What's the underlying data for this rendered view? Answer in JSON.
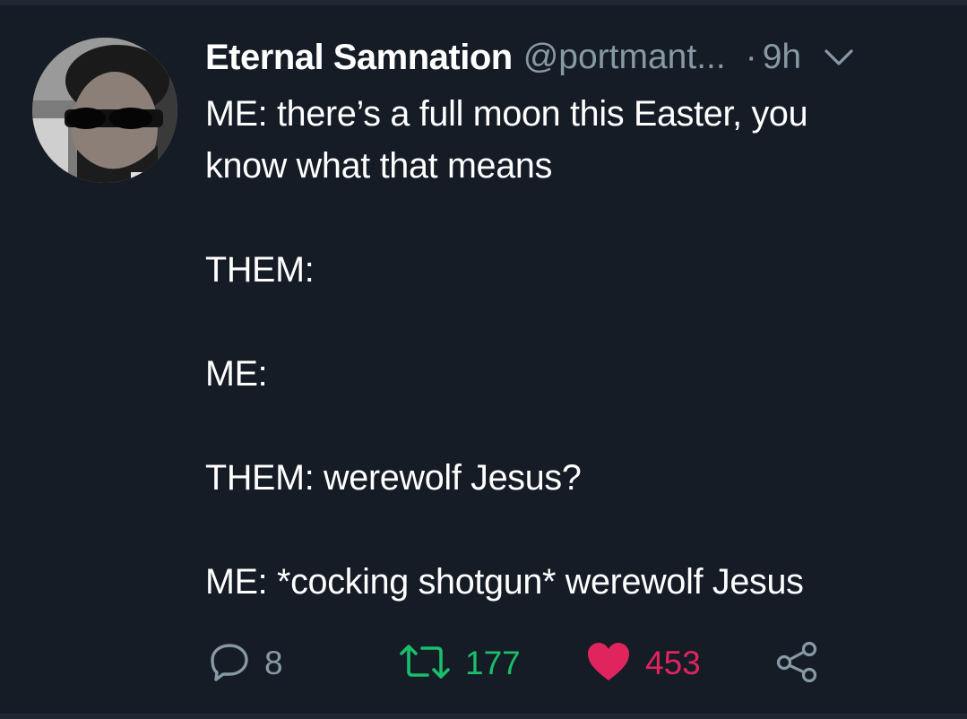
{
  "tweet": {
    "display_name": "Eternal Samnation",
    "handle": "@portmant...",
    "separator": "·",
    "time": "9h",
    "lines": [
      "ME: there’s a full moon this Easter, you",
      "know what that means",
      "",
      "THEM:",
      "",
      "ME:",
      "",
      "THEM: werewolf Jesus?",
      "",
      "ME: *cocking shotgun* werewolf Jesus"
    ]
  },
  "actions": {
    "reply_count": "8",
    "retweet_count": "177",
    "like_count": "453"
  },
  "icons": {
    "reply": "reply-icon",
    "retweet": "retweet-icon",
    "like": "heart-icon",
    "share": "share-icon",
    "caret": "chevron-down-icon"
  },
  "colors": {
    "background": "#151c26",
    "secondary_text": "#8899a6",
    "retweet_green": "#19bf6b",
    "like_red": "#e0245e"
  }
}
